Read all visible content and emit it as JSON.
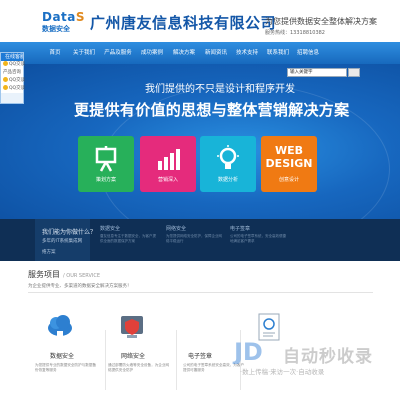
{
  "header": {
    "logo_main": "Data",
    "logo_s": "S",
    "logo_sub": "数据安全",
    "company": "广州唐友信息科技有限公司",
    "slogan": "为您提供数据安全整体解决方案",
    "hotline": "服务热线：13318810382"
  },
  "nav": {
    "items": [
      "首页",
      "关于我们",
      "产品及服务",
      "成功案例",
      "解决方案",
      "新闻资讯",
      "技术支持",
      "联系我们",
      "招聘信息"
    ]
  },
  "sidebar": {
    "title": "在线客服",
    "rows": [
      "QQ交谈",
      "产品咨询",
      "QQ交谈",
      "QQ交谈"
    ]
  },
  "search": {
    "placeholder": "输入关键字"
  },
  "hero": {
    "line1": "我们提供的不只是设计和程序开发",
    "line2": "更提供有价值的思想与整体营销解决方案",
    "tiles": [
      {
        "label": "策划方案",
        "color": "#27b05a"
      },
      {
        "label": "营销深入",
        "color": "#e52b7c"
      },
      {
        "label": "数据分析",
        "color": "#18b4d8"
      },
      {
        "label": "创意设计",
        "color": "#f07a13"
      }
    ],
    "web_design": [
      "WEB",
      "DESIGN"
    ]
  },
  "strip": {
    "question": "我们能为你做什么？",
    "line_a": "多年的IT系统集成网",
    "line_b": "络方案",
    "cols": [
      {
        "title": "数据安全",
        "desc": "唐友信息专注于数据安全，为客户提供全面的数据保护方案"
      },
      {
        "title": "网络安全",
        "desc": "为您提供网络安全防护，保障企业网络平稳运行"
      },
      {
        "title": "电子签章",
        "desc": "公司的电子签章系统，安全高效便捷地满足客户需求"
      }
    ]
  },
  "services": {
    "title": "服务项目",
    "title_en": "/ OUR SERVICE",
    "subtitle": "为企业提供专业、多渠道的数据安全解决方案服务！",
    "items": [
      {
        "name": "数据安全",
        "desc": "为您提供专业的数据安全防护与数据备份恢复等服务"
      },
      {
        "name": "网络安全",
        "desc": "通过部署防火墙等安全设备，为企业网络提供安全防护"
      },
      {
        "name": "电子签章",
        "desc": "公司的电子签章系统安全高效，为客户提供可靠服务"
      }
    ]
  },
  "watermark": {
    "text": "自动秒收录",
    "url": "·数上传稿·来访一次·自动收录"
  }
}
